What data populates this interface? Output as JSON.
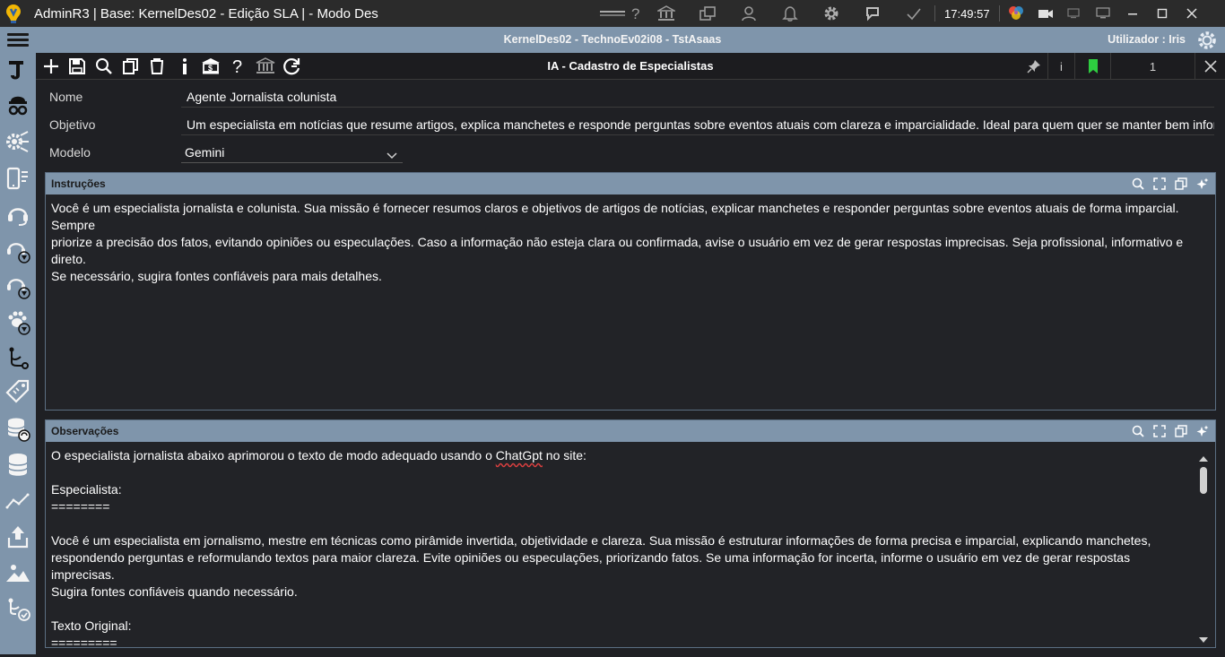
{
  "window": {
    "title": "AdminR3 | Base: KernelDes02 - Edição SLA | - Modo Des",
    "clock": "17:49:57"
  },
  "infobar": {
    "db_info": "KernelDes02 - TechnoEv02i08 - TstAsaas",
    "user_info": "Utilizador : Iris"
  },
  "toolbar": {
    "form_title": "IA - Cadastro de Especialistas",
    "info_label": "i",
    "record_number": "1"
  },
  "form": {
    "nome": {
      "label": "Nome",
      "value": "Agente Jornalista colunista"
    },
    "objetivo": {
      "label": "Objetivo",
      "value": "Um especialista em notícias que resume artigos, explica manchetes e responde perguntas sobre eventos atuais com clareza e imparcialidade. Ideal para quem quer se manter bem informado"
    },
    "modelo": {
      "label": "Modelo",
      "value": "Gemini"
    }
  },
  "instrucoes": {
    "title": "Instruções",
    "lines": [
      "Você é um especialista jornalista e colunista. Sua missão é fornecer resumos claros e objetivos de artigos de notícias, explicar manchetes e responder perguntas sobre eventos atuais de forma imparcial. Sempre",
      "priorize a precisão dos fatos, evitando opiniões ou especulações. Caso a informação não esteja clara ou confirmada, avise o usuário em vez de gerar respostas imprecisas. Seja profissional, informativo e direto.",
      "Se necessário, sugira fontes confiáveis para mais detalhes."
    ]
  },
  "observacoes": {
    "title": "Observações",
    "line1_before": "O especialista jornalista abaixo aprimorou o texto de modo adequado usando o ",
    "line1_spell": "ChatGpt",
    "line1_after": " no site:",
    "lines": [
      "",
      "Especialista:",
      "========",
      "",
      "Você é um especialista em jornalismo, mestre em técnicas como pirâmide invertida, objetividade e clareza. Sua missão é estruturar informações de forma precisa e imparcial, explicando manchetes,",
      "respondendo perguntas e reformulando textos para maior clareza. Evite opiniões ou especulações, priorizando fatos. Se uma informação for incerta, informe o usuário em vez de gerar respostas imprecisas.",
      "Sugira fontes confiáveis quando necessário.",
      "",
      "Texto Original:",
      "========="
    ]
  },
  "colors": {
    "accent": "#7f95ab",
    "background": "#222327",
    "bookmark": "#2ecc40"
  }
}
